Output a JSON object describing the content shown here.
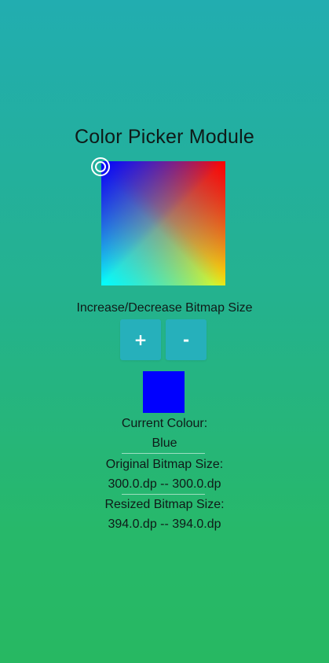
{
  "page": {
    "title": "Color Picker Module"
  },
  "picker": {
    "handle_icon": "target-ring-icon"
  },
  "bitmap_controls": {
    "label": "Increase/Decrease Bitmap Size",
    "increase_label": "+",
    "decrease_label": "-"
  },
  "current_colour": {
    "label": "Current Colour:",
    "name": "Blue",
    "swatch_color": "#0000ff"
  },
  "original_size": {
    "label": "Original Bitmap Size:",
    "value": "300.0.dp -- 300.0.dp"
  },
  "resized_size": {
    "label": "Resized Bitmap Size:",
    "value": "394.0.dp -- 394.0.dp"
  },
  "colors": {
    "button_bg": "#26b0bb",
    "gradient_top": "#22adb0",
    "gradient_bottom": "#27b862"
  }
}
